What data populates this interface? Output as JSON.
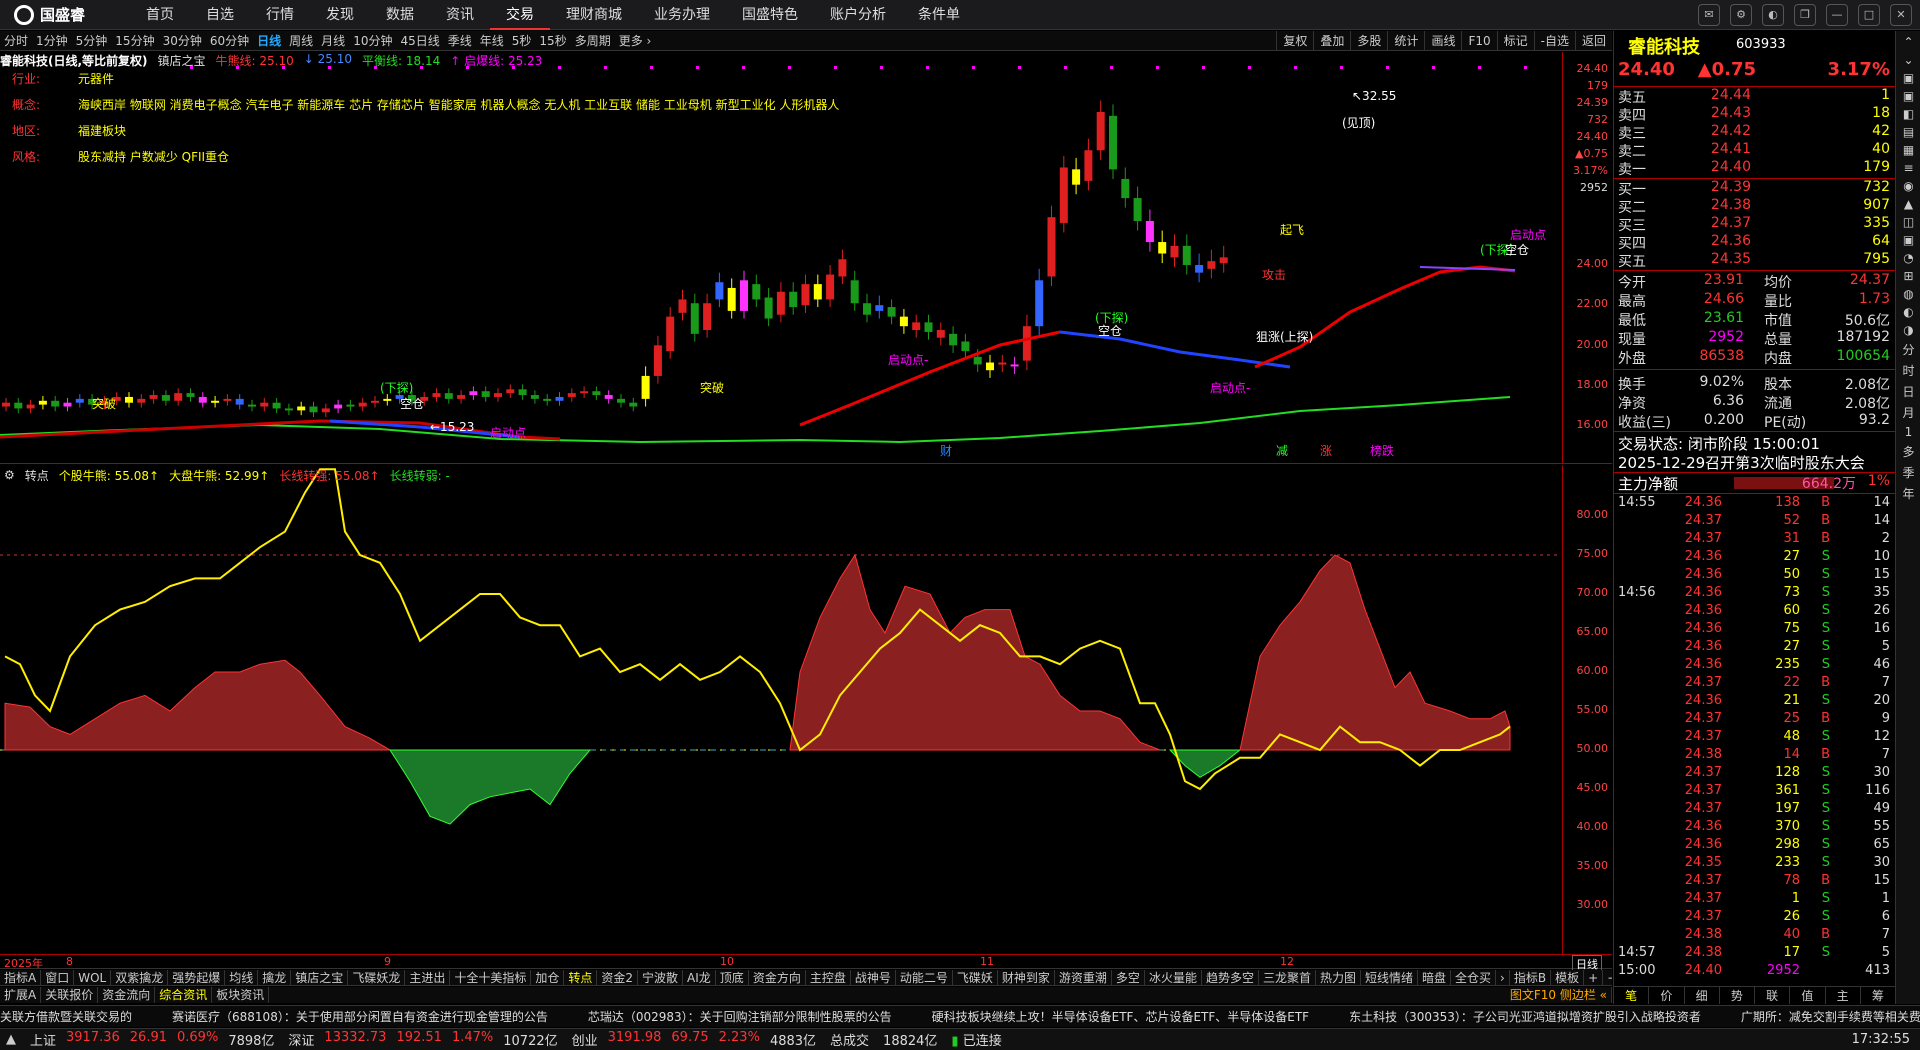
{
  "app": {
    "logo": "国盛睿"
  },
  "menu": [
    "首页",
    "自选",
    "行情",
    "发现",
    "数据",
    "资讯",
    "交易",
    "理财商城",
    "业务办理",
    "国盛特色",
    "账户分析",
    "条件单"
  ],
  "menu_active": "交易",
  "periods": [
    "分时",
    "1分钟",
    "5分钟",
    "15分钟",
    "30分钟",
    "60分钟",
    "日线",
    "周线",
    "月线",
    "10分钟",
    "45日线",
    "季线",
    "年线",
    "5秒",
    "15秒",
    "多周期",
    "更多 ›"
  ],
  "period_active": "日线",
  "toolbar_right": [
    "复权",
    "叠加",
    "多股",
    "统计",
    "画线",
    "F10",
    "标记",
    "-自选",
    "返回"
  ],
  "kline": {
    "title": "睿能科技(日线,等比前复权)",
    "indicator": "镇店之宝",
    "lines": [
      {
        "label": "牛熊线: 25.10",
        "color": "#f33"
      },
      {
        "label": "↓ 25.10",
        "color": "#48f"
      },
      {
        "label": "平衡线: 18.14",
        "color": "#2d2"
      },
      {
        "label": "↑ 启爆线: 25.23",
        "color": "#f0f"
      }
    ],
    "info": [
      {
        "k": "行业:",
        "v": "元器件"
      },
      {
        "k": "概念:",
        "v": "海峡西岸 物联网 消费电子概念 汽车电子 新能源车 芯片 存储芯片 智能家居 机器人概念 无人机 工业互联 储能 工业母机 新型工业化 人形机器人"
      },
      {
        "k": "地区:",
        "v": "福建板块"
      },
      {
        "k": "风格:",
        "v": "股东减持 户数减少 QFII重仓"
      }
    ],
    "y_ticks": [
      "24.00",
      "22.00",
      "20.00",
      "18.00",
      "16.00"
    ],
    "y_top": [
      "24.40",
      "179",
      "24.39",
      "732",
      "24.40",
      "▲0.75",
      "3.17%",
      "2952"
    ],
    "annotations": [
      "32.55",
      "←15.23",
      "(下探)",
      "空仓",
      "(下探)",
      "空仓",
      "(下探)",
      "空仓",
      "突破",
      "启动点",
      "启动点-",
      "启动点",
      "起飞",
      "攻击",
      "狙涨",
      "(见顶)",
      "财",
      "减",
      "涨",
      "榜跌"
    ]
  },
  "osc": {
    "title": "转点",
    "items": [
      {
        "label": "个股牛熊: 55.08↑",
        "color": "#ff0"
      },
      {
        "label": "大盘牛熊: 52.99↑",
        "color": "#ff0"
      },
      {
        "label": "长线转强: 55.08↑",
        "color": "#f33"
      },
      {
        "label": "长线转弱: -",
        "color": "#2d2"
      }
    ],
    "y_ticks": [
      "80.00",
      "75.00",
      "70.00",
      "65.00",
      "60.00",
      "55.00",
      "50.00",
      "45.00",
      "40.00",
      "35.00",
      "30.00"
    ]
  },
  "dates": [
    {
      "t": "2025年",
      "x": 4
    },
    {
      "t": "8",
      "x": 66
    },
    {
      "t": "9",
      "x": 384
    },
    {
      "t": "10",
      "x": 720
    },
    {
      "t": "11",
      "x": 980
    },
    {
      "t": "12",
      "x": 1280
    }
  ],
  "ind_tabs": [
    "指标A",
    "窗口",
    "WOL",
    "双紫擒龙",
    "强势起爆",
    "均线",
    "擒龙",
    "镇店之宝",
    "飞碟妖龙",
    "主进出",
    "十全十美指标",
    "加仓",
    "转点",
    "资金2",
    "宁波散",
    "AI龙",
    "顶底",
    "资金方向",
    "主控盘",
    "战神号",
    "动能二号",
    "飞碟妖",
    "财神到家",
    "游资重潮",
    "多空",
    "冰火量能",
    "趋势多空",
    "三龙聚首",
    "热力图",
    "短线情绪",
    "暗盘",
    "全仓买",
    "›",
    "指标B",
    "模板",
    "+",
    "−"
  ],
  "ind_active": "转点",
  "bottom_tabs": [
    "扩展A",
    "关联报价",
    "资金流向",
    "综合资讯",
    "板块资讯"
  ],
  "bottom_right": "图文F10  侧边栏 «",
  "news": [
    "关联方借款暨关联交易的",
    "赛诺医疗（688108）：关于使用部分闲置自有资金进行现金管理的公告",
    "芯瑞达（002983）：关于回购注销部分限制性股票的公告",
    "硬科技板块继续上攻！半导体设备ETF、芯片设备ETF、半导体设备ETF",
    "东土科技（300353）：子公司光亚鸿道拟增资扩股引入战略投资者",
    "广期所：减免交割手续费等相关费"
  ],
  "status": {
    "indices": [
      {
        "name": "上证",
        "value": "3917.36",
        "chg": "26.91",
        "pct": "0.69%",
        "amt": "7898亿"
      },
      {
        "name": "深证",
        "value": "13332.73",
        "chg": "192.51",
        "pct": "1.47%",
        "amt": "10722亿"
      },
      {
        "name": "创业",
        "value": "3191.98",
        "chg": "69.75",
        "pct": "2.23%",
        "amt": "4883亿"
      }
    ],
    "total_label": "总成交",
    "total": "18824亿",
    "conn": "已连接",
    "time": "17:32:55"
  },
  "stock": {
    "name": "睿能科技",
    "code": "603933",
    "price": "24.40",
    "change": "▲0.75",
    "pct": "3.17%",
    "asks": [
      {
        "l": "卖五",
        "p": "24.44",
        "v": "1"
      },
      {
        "l": "卖四",
        "p": "24.43",
        "v": "18"
      },
      {
        "l": "卖三",
        "p": "24.42",
        "v": "42"
      },
      {
        "l": "卖二",
        "p": "24.41",
        "v": "40"
      },
      {
        "l": "卖一",
        "p": "24.40",
        "v": "179"
      }
    ],
    "bids": [
      {
        "l": "买一",
        "p": "24.39",
        "v": "732"
      },
      {
        "l": "买二",
        "p": "24.38",
        "v": "907"
      },
      {
        "l": "买三",
        "p": "24.37",
        "v": "335"
      },
      {
        "l": "买四",
        "p": "24.36",
        "v": "64"
      },
      {
        "l": "买五",
        "p": "24.35",
        "v": "795"
      }
    ],
    "stats": [
      {
        "a": "今开",
        "av": "23.91",
        "b": "均价",
        "bv": "24.37",
        "ac": "up",
        "bc": "up"
      },
      {
        "a": "最高",
        "av": "24.66",
        "b": "量比",
        "bv": "1.73",
        "ac": "up",
        "bc": "up"
      },
      {
        "a": "最低",
        "av": "23.61",
        "b": "市值",
        "bv": "50.6亿",
        "ac": "dn",
        "bc": "wt"
      },
      {
        "a": "现量",
        "av": "2952",
        "b": "总量",
        "bv": "187192",
        "ac": "mg",
        "bc": "wt"
      },
      {
        "a": "外盘",
        "av": "86538",
        "b": "内盘",
        "bv": "100654",
        "ac": "up",
        "bc": "dn"
      },
      {
        "a": "换手",
        "av": "9.02%",
        "b": "股本",
        "bv": "2.08亿",
        "ac": "wt",
        "bc": "wt"
      },
      {
        "a": "净资",
        "av": "6.36",
        "b": "流通",
        "bv": "2.08亿",
        "ac": "wt",
        "bc": "wt"
      },
      {
        "a": "收益(三)",
        "av": "0.200",
        "b": "PE(动)",
        "bv": "93.2",
        "ac": "wt",
        "bc": "wt"
      }
    ],
    "trade_status": "交易状态: 闭市阶段 15:00:01",
    "event": "2025-12-29召开第3次临时股东大会",
    "mainflow_label": "主力净额",
    "mainflow": "664.2万",
    "mainflow_pct": "1%",
    "ticks": [
      {
        "t": "14:55",
        "p": "24.36",
        "v": "138",
        "d": "B",
        "n": "14"
      },
      {
        "t": "",
        "p": "24.37",
        "v": "52",
        "d": "B",
        "n": "14"
      },
      {
        "t": "",
        "p": "24.37",
        "v": "31",
        "d": "B",
        "n": "2"
      },
      {
        "t": "",
        "p": "24.36",
        "v": "27",
        "d": "S",
        "n": "10"
      },
      {
        "t": "",
        "p": "24.36",
        "v": "50",
        "d": "S",
        "n": "15"
      },
      {
        "t": "14:56",
        "p": "24.36",
        "v": "73",
        "d": "S",
        "n": "35"
      },
      {
        "t": "",
        "p": "24.36",
        "v": "60",
        "d": "S",
        "n": "26"
      },
      {
        "t": "",
        "p": "24.36",
        "v": "75",
        "d": "S",
        "n": "16"
      },
      {
        "t": "",
        "p": "24.36",
        "v": "27",
        "d": "S",
        "n": "5"
      },
      {
        "t": "",
        "p": "24.36",
        "v": "235",
        "d": "S",
        "n": "46"
      },
      {
        "t": "",
        "p": "24.37",
        "v": "22",
        "d": "B",
        "n": "7"
      },
      {
        "t": "",
        "p": "24.36",
        "v": "21",
        "d": "S",
        "n": "20"
      },
      {
        "t": "",
        "p": "24.37",
        "v": "25",
        "d": "B",
        "n": "9"
      },
      {
        "t": "",
        "p": "24.37",
        "v": "48",
        "d": "S",
        "n": "12"
      },
      {
        "t": "",
        "p": "24.38",
        "v": "14",
        "d": "B",
        "n": "7"
      },
      {
        "t": "",
        "p": "24.37",
        "v": "128",
        "d": "S",
        "n": "30"
      },
      {
        "t": "",
        "p": "24.37",
        "v": "361",
        "d": "S",
        "n": "116"
      },
      {
        "t": "",
        "p": "24.37",
        "v": "197",
        "d": "S",
        "n": "49"
      },
      {
        "t": "",
        "p": "24.36",
        "v": "370",
        "d": "S",
        "n": "55"
      },
      {
        "t": "",
        "p": "24.36",
        "v": "298",
        "d": "S",
        "n": "65"
      },
      {
        "t": "",
        "p": "24.35",
        "v": "233",
        "d": "S",
        "n": "30"
      },
      {
        "t": "",
        "p": "24.37",
        "v": "78",
        "d": "B",
        "n": "15"
      },
      {
        "t": "",
        "p": "24.37",
        "v": "1",
        "d": "S",
        "n": "1"
      },
      {
        "t": "",
        "p": "24.37",
        "v": "26",
        "d": "S",
        "n": "6"
      },
      {
        "t": "",
        "p": "24.38",
        "v": "40",
        "d": "B",
        "n": "7"
      },
      {
        "t": "14:57",
        "p": "24.38",
        "v": "17",
        "d": "S",
        "n": "5"
      },
      {
        "t": "15:00",
        "p": "24.40",
        "v": "2952",
        "d": "",
        "n": "413"
      }
    ],
    "bottom_tabs": [
      "笔",
      "价",
      "细",
      "势",
      "联",
      "值",
      "主",
      "筹"
    ]
  },
  "vtabs": [
    "⌃",
    "⌄",
    "▣",
    "▣",
    "◧",
    "▤",
    "▦",
    "≡",
    "◉",
    "▲",
    "◫",
    "▣",
    "◔",
    "⊞",
    "◍",
    "◐",
    "◑",
    "分",
    "时",
    "日",
    "月",
    "1",
    "多",
    "季",
    "年"
  ],
  "colors": {
    "up": "#ff3333",
    "down": "#22cc22",
    "gold": "#ffff00",
    "magenta": "#ff00ff",
    "axis": "#aa0000"
  }
}
